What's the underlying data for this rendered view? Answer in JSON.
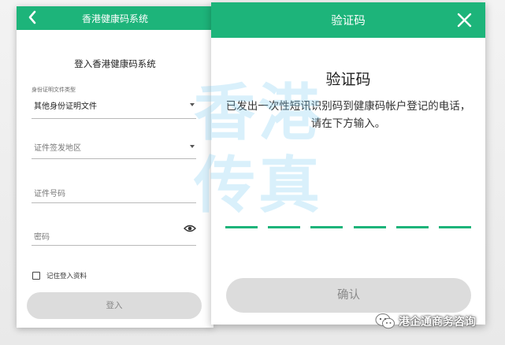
{
  "login_screen": {
    "header_title": "香港健康码系统",
    "heading": "登入香港健康码系统",
    "doc_type": {
      "label": "身份证明文件类型",
      "value": "其他身份证明文件"
    },
    "issue_region": {
      "placeholder": "证件签发地区"
    },
    "doc_number": {
      "placeholder": "证件号码"
    },
    "password": {
      "placeholder": "密码"
    },
    "remember_label": "记住登入资料",
    "login_button": "登入"
  },
  "otp_dialog": {
    "header_title": "验证码",
    "heading": "验证码",
    "description": "已发出一次性短讯识别码到健康码帐户登记的电话，请在下方输入。",
    "slot_count": 6,
    "confirm_button": "确认"
  },
  "watermark": {
    "line1": "香港",
    "line2": "传真"
  },
  "source": {
    "label": "港企通商务咨询"
  },
  "colors": {
    "brand_green": "#1db47a",
    "disabled_button": "#dcdcdc"
  }
}
